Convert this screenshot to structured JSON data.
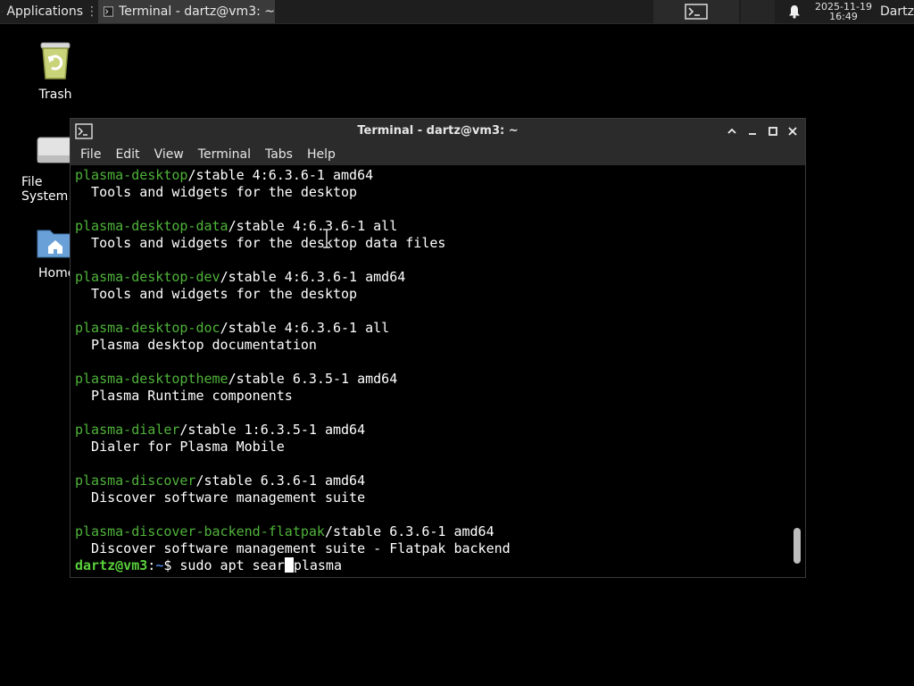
{
  "panel": {
    "applications_label": "Applications",
    "task_label": "Terminal - dartz@vm3: ~",
    "clock_date": "2025-11-19",
    "clock_time": "16:49",
    "user_label": "Dartz"
  },
  "desktop": {
    "icons": [
      {
        "label": "Trash",
        "icon": "trash-icon"
      },
      {
        "label": "File System",
        "icon": "drive-icon"
      },
      {
        "label": "Home",
        "icon": "home-folder-icon"
      }
    ]
  },
  "window": {
    "title": "Terminal - dartz@vm3: ~",
    "menu": [
      "File",
      "Edit",
      "View",
      "Terminal",
      "Tabs",
      "Help"
    ]
  },
  "terminal": {
    "entries": [
      {
        "pkg": "plasma-desktop",
        "info": "/stable 4:6.3.6-1 amd64",
        "desc": "  Tools and widgets for the desktop"
      },
      {
        "pkg": "plasma-desktop-data",
        "info": "/stable 4:6.3.6-1 all",
        "desc": "  Tools and widgets for the desktop data files"
      },
      {
        "pkg": "plasma-desktop-dev",
        "info": "/stable 4:6.3.6-1 amd64",
        "desc": "  Tools and widgets for the desktop"
      },
      {
        "pkg": "plasma-desktop-doc",
        "info": "/stable 4:6.3.6-1 all",
        "desc": "  Plasma desktop documentation"
      },
      {
        "pkg": "plasma-desktoptheme",
        "info": "/stable 6.3.5-1 amd64",
        "desc": "  Plasma Runtime components"
      },
      {
        "pkg": "plasma-dialer",
        "info": "/stable 1:6.3.5-1 amd64",
        "desc": "  Dialer for Plasma Mobile"
      },
      {
        "pkg": "plasma-discover",
        "info": "/stable 6.3.6-1 amd64",
        "desc": "  Discover software management suite"
      },
      {
        "pkg": "plasma-discover-backend-flatpak",
        "info": "/stable 6.3.6-1 amd64",
        "desc": "  Discover software management suite - Flatpak backend"
      }
    ],
    "prompt_user": "dartz@vm3",
    "prompt_sep": ":",
    "prompt_path": "~",
    "prompt_symbol": "$ ",
    "command_before_cursor": "sudo apt sear",
    "command_after_cursor": "plasma",
    "scroll_position": 0.97
  },
  "colors": {
    "package_name": "#4fb33a",
    "prompt_user": "#5ad13c",
    "prompt_path": "#4a7fd9"
  }
}
